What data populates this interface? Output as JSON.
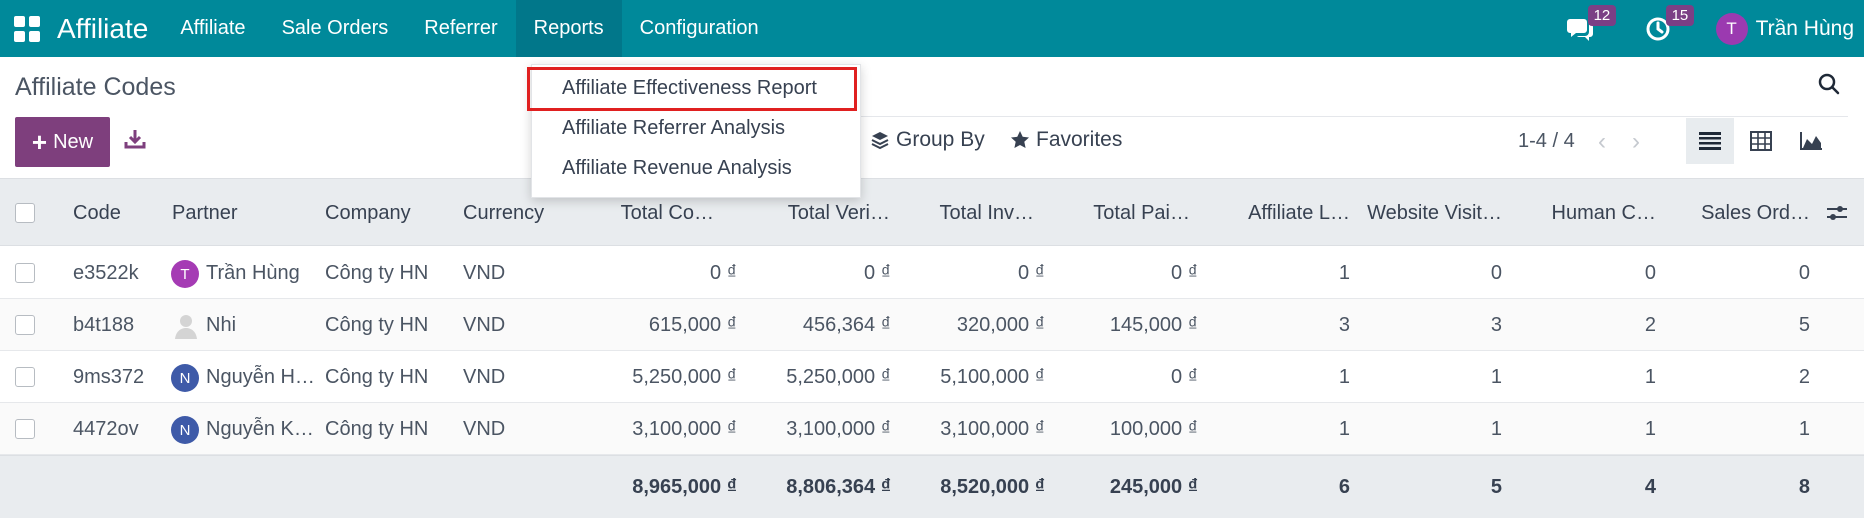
{
  "navbar": {
    "app_title": "Affiliate",
    "menu": [
      "Affiliate",
      "Sale Orders",
      "Referrer",
      "Reports",
      "Configuration"
    ],
    "messages_badge": "12",
    "activities_badge": "15",
    "user_initial": "T",
    "user_name": "Trần Hùng",
    "accent_color": "#00899a"
  },
  "breadcrumb": "Affiliate Codes",
  "toolbar": {
    "new_label": "New",
    "group_by": "Group By",
    "favorites": "Favorites",
    "pager": "1-4 / 4"
  },
  "reports_menu": {
    "items": [
      "Affiliate Effectiveness Report",
      "Affiliate Referrer Analysis",
      "Affiliate Revenue Analysis"
    ],
    "highlighted": "Affiliate Effectiveness Report"
  },
  "table": {
    "columns": [
      "Code",
      "Partner",
      "Company",
      "Currency",
      "Total Co…",
      "Total Veri…",
      "Total Inv…",
      "Total Pai…",
      "Affiliate L…",
      "Website Visit…",
      "Human C…",
      "Sales Ord…"
    ],
    "rows": [
      {
        "code": "e3522k",
        "avatar": "T",
        "avatar_color": "#a53bb4",
        "partner": "Trần Hùng",
        "company": "Công ty HN",
        "currency": "VND",
        "total_co": "0 ₫",
        "total_veri": "0 ₫",
        "total_inv": "0 ₫",
        "total_pai": "0 ₫",
        "affiliate_l": "1",
        "website_visit": "0",
        "human_c": "0",
        "sales_ord": "0"
      },
      {
        "code": "b4t188",
        "avatar": "",
        "avatar_color": "",
        "partner": "Nhi",
        "company": "Công ty HN",
        "currency": "VND",
        "total_co": "615,000 ₫",
        "total_veri": "456,364 ₫",
        "total_inv": "320,000 ₫",
        "total_pai": "145,000 ₫",
        "affiliate_l": "3",
        "website_visit": "3",
        "human_c": "2",
        "sales_ord": "5"
      },
      {
        "code": "9ms372",
        "avatar": "N",
        "avatar_color": "#3e5aa8",
        "partner": "Nguyễn H…",
        "company": "Công ty HN",
        "currency": "VND",
        "total_co": "5,250,000 ₫",
        "total_veri": "5,250,000 ₫",
        "total_inv": "5,100,000 ₫",
        "total_pai": "0 ₫",
        "affiliate_l": "1",
        "website_visit": "1",
        "human_c": "1",
        "sales_ord": "2"
      },
      {
        "code": "4472ov",
        "avatar": "N",
        "avatar_color": "#3e5aa8",
        "partner": "Nguyễn K…",
        "company": "Công ty HN",
        "currency": "VND",
        "total_co": "3,100,000 ₫",
        "total_veri": "3,100,000 ₫",
        "total_inv": "3,100,000 ₫",
        "total_pai": "100,000 ₫",
        "affiliate_l": "1",
        "website_visit": "1",
        "human_c": "1",
        "sales_ord": "1"
      }
    ],
    "totals": {
      "total_co": "8,965,000 ₫",
      "total_veri": "8,806,364 ₫",
      "total_inv": "8,520,000 ₫",
      "total_pai": "245,000 ₫",
      "affiliate_l": "6",
      "website_visit": "5",
      "human_c": "4",
      "sales_ord": "8"
    }
  }
}
